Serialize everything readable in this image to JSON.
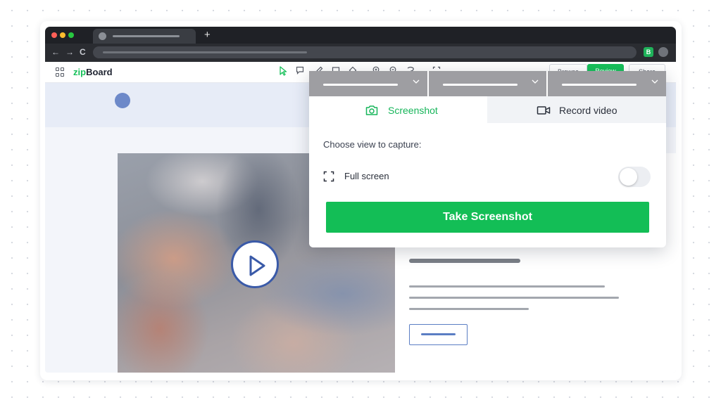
{
  "app": {
    "brand_prefix": "zip",
    "brand_suffix": "Board",
    "accent_color": "#17c05a",
    "link_color": "#3a5aa8"
  },
  "browser": {
    "tab_icon": "favicon",
    "new_tab_label": "+",
    "back_label": "←",
    "forward_label": "→",
    "reload_label": "C",
    "extension_label": "B"
  },
  "toolbar": {
    "tools": [
      "select-cursor-icon",
      "comment-icon",
      "pen-icon",
      "rectangle-icon",
      "shape-icon",
      "zoom-in-icon",
      "zoom-out-icon",
      "lasso-icon",
      "fullscreen-icon"
    ],
    "browse_label": "Browse",
    "review_label": "Review",
    "share_label": "Share"
  },
  "capture_panel": {
    "tabs": [
      {
        "label": "Screenshot",
        "icon": "camera-icon",
        "active": true
      },
      {
        "label": "Record video",
        "icon": "video-camera-icon",
        "active": false
      }
    ],
    "choose_label": "Choose view to capture:",
    "full_screen_label": "Full screen",
    "full_screen_enabled": false,
    "take_button_label": "Take Screenshot",
    "dropdown_count": 3
  },
  "content": {
    "video_icon": "play-icon"
  }
}
